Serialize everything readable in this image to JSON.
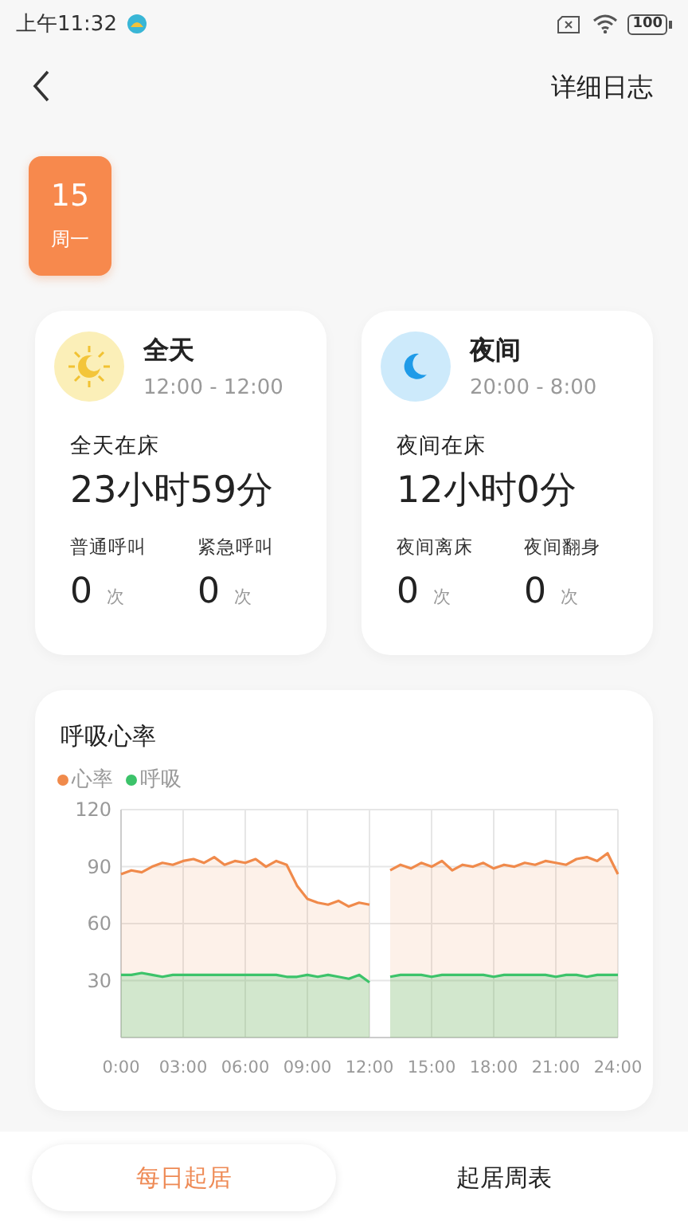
{
  "status_bar": {
    "time": "上午11:32",
    "battery": "100"
  },
  "header": {
    "action": "详细日志"
  },
  "date": {
    "day": "15",
    "weekday": "周一"
  },
  "cards": [
    {
      "kind": "day",
      "title": "全天",
      "range": "12:00 - 12:00",
      "total_label": "全天在床",
      "total": "23小时59分",
      "stats": [
        {
          "label": "普通呼叫",
          "value": "0",
          "unit": "次"
        },
        {
          "label": "紧急呼叫",
          "value": "0",
          "unit": "次"
        }
      ]
    },
    {
      "kind": "night",
      "title": "夜间",
      "range": "20:00 - 8:00",
      "total_label": "夜间在床",
      "total": "12小时0分",
      "stats": [
        {
          "label": "夜间离床",
          "value": "0",
          "unit": "次"
        },
        {
          "label": "夜间翻身",
          "value": "0",
          "unit": "次"
        }
      ]
    }
  ],
  "chart_card": {
    "title": "呼吸心率",
    "chart_data": {
      "type": "area",
      "grid": true,
      "xlim": [
        0,
        24
      ],
      "ylim": [
        0,
        120
      ],
      "x": [
        0,
        0.5,
        1,
        1.5,
        2,
        2.5,
        3,
        3.5,
        4,
        4.5,
        5,
        5.5,
        6,
        6.5,
        7,
        7.5,
        8,
        8.5,
        9,
        9.5,
        10,
        10.5,
        11,
        11.5,
        12,
        12.5,
        13,
        13.5,
        14,
        14.5,
        15,
        15.5,
        16,
        16.5,
        17,
        17.5,
        18,
        18.5,
        19,
        19.5,
        20,
        20.5,
        21,
        21.5,
        22,
        22.5,
        23,
        23.5,
        24
      ],
      "series": [
        {
          "name": "心率",
          "color": "#f08a4b",
          "values": [
            86,
            88,
            87,
            90,
            92,
            91,
            93,
            94,
            92,
            95,
            91,
            93,
            92,
            94,
            90,
            93,
            91,
            80,
            73,
            71,
            70,
            72,
            69,
            71,
            70,
            null,
            88,
            91,
            89,
            92,
            90,
            93,
            88,
            91,
            90,
            92,
            89,
            91,
            90,
            92,
            91,
            93,
            92,
            91,
            94,
            95,
            93,
            97,
            86
          ]
        },
        {
          "name": "呼吸",
          "color": "#3cc36a",
          "values": [
            33,
            33,
            34,
            33,
            32,
            33,
            33,
            33,
            33,
            33,
            33,
            33,
            33,
            33,
            33,
            33,
            32,
            32,
            33,
            32,
            33,
            32,
            31,
            33,
            29,
            null,
            32,
            33,
            33,
            33,
            32,
            33,
            33,
            33,
            33,
            33,
            32,
            33,
            33,
            33,
            33,
            33,
            32,
            33,
            33,
            32,
            33,
            33,
            33
          ]
        }
      ],
      "xticks": [
        {
          "value": 0,
          "label": "0:00"
        },
        {
          "value": 3,
          "label": "03:00"
        },
        {
          "value": 6,
          "label": "06:00"
        },
        {
          "value": 9,
          "label": "09:00"
        },
        {
          "value": 12,
          "label": "12:00"
        },
        {
          "value": 15,
          "label": "15:00"
        },
        {
          "value": 18,
          "label": "18:00"
        },
        {
          "value": 21,
          "label": "21:00"
        },
        {
          "value": 24,
          "label": "24:00"
        }
      ],
      "yticks": [
        30,
        60,
        90,
        120
      ]
    }
  },
  "tabs": [
    {
      "label": "每日起居",
      "selected": true
    },
    {
      "label": "起居周表",
      "selected": false
    }
  ]
}
